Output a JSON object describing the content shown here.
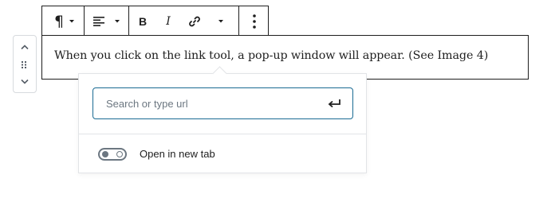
{
  "mover": {
    "up_icon": "chevron-up-icon",
    "drag_icon": "drag-handle-icon",
    "down_icon": "chevron-down-icon"
  },
  "toolbar": {
    "buttons": [
      {
        "name": "paragraph",
        "icon": "paragraph-icon",
        "label": "¶"
      },
      {
        "name": "align",
        "icon": "align-left-icon"
      },
      {
        "name": "bold",
        "icon": "bold-icon",
        "label": "B"
      },
      {
        "name": "italic",
        "icon": "italic-icon",
        "label": "I"
      },
      {
        "name": "link",
        "icon": "link-icon"
      },
      {
        "name": "more-rich-text",
        "icon": "chevron-down-icon"
      },
      {
        "name": "more-options",
        "icon": "vertical-ellipsis-icon"
      }
    ]
  },
  "block": {
    "text": "When you click on the link tool, a pop-up window will appear. (See Image 4)"
  },
  "link_popover": {
    "input_placeholder": "Search or type url",
    "input_value": "",
    "submit_icon": "enter-return-icon",
    "toggle_label": "Open in new tab",
    "toggle_on": false
  },
  "colors": {
    "focus_border": "#1a6b93",
    "border_dark": "#1e1e1e",
    "border_light": "#e2e4e7",
    "muted": "#6c7781"
  }
}
